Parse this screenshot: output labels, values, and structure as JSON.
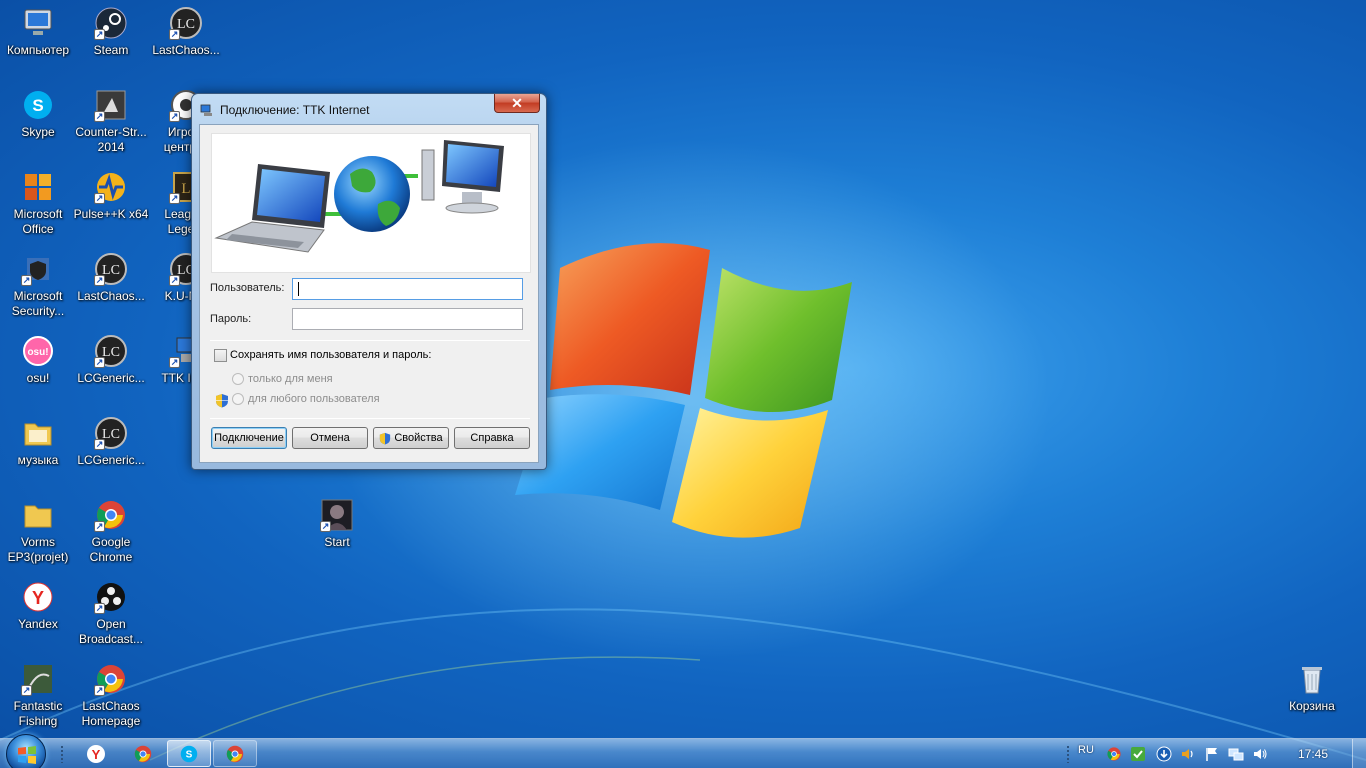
{
  "desktop": {
    "icons": [
      {
        "label": "Компьютер",
        "icon": "computer-icon"
      },
      {
        "label": "Steam",
        "icon": "steam-icon"
      },
      {
        "label": "LastChaos...",
        "icon": "lastchaos-icon"
      },
      {
        "label": "Skype",
        "icon": "skype-icon"
      },
      {
        "label": "Counter-Str... 2014",
        "icon": "counter-strike-icon"
      },
      {
        "label": "Игро... центр@",
        "icon": "game-center-icon"
      },
      {
        "label": "Microsoft Office",
        "icon": "office-icon"
      },
      {
        "label": "Pulse++K x64",
        "icon": "pulse-icon"
      },
      {
        "label": "Leagu... Lege...",
        "icon": "league-icon"
      },
      {
        "label": "Microsoft Security...",
        "icon": "security-icon"
      },
      {
        "label": "LastChaos...",
        "icon": "lastchaos-icon"
      },
      {
        "label": "K.U-N...",
        "icon": "lastchaos-icon"
      },
      {
        "label": "osu!",
        "icon": "osu-icon"
      },
      {
        "label": "LCGeneric...",
        "icon": "lastchaos-icon"
      },
      {
        "label": "TTK Int...",
        "icon": "network-connection-icon"
      },
      {
        "label": "музыка",
        "icon": "folder-icon"
      },
      {
        "label": "LCGeneric...",
        "icon": "lastchaos-icon"
      },
      {
        "label": "Vorms EP3(projet)",
        "icon": "folder-icon"
      },
      {
        "label": "Google Chrome",
        "icon": "chrome-icon"
      },
      {
        "label": "Start",
        "icon": "start-game-icon"
      },
      {
        "label": "Yandex",
        "icon": "yandex-icon"
      },
      {
        "label": "Open Broadcast...",
        "icon": "obs-icon"
      },
      {
        "label": "Fantastic Fishing",
        "icon": "fishing-icon"
      },
      {
        "label": "LastChaos Homepage",
        "icon": "chrome-icon"
      },
      {
        "label": "Корзина",
        "icon": "recycle-bin-icon"
      }
    ]
  },
  "dialog": {
    "title": "Подключение: TTK Internet",
    "close_label": "✕",
    "username_label": "Пользователь:",
    "username_value": "",
    "password_label": "Пароль:",
    "password_value": "",
    "save_credentials_label": "Сохранять имя пользователя и пароль:",
    "save_credentials_checked": false,
    "option_only_me": "только для меня",
    "option_any_user": "для любого пользователя",
    "buttons": {
      "connect": "Подключение",
      "cancel": "Отмена",
      "properties": "Свойства",
      "help": "Справка"
    }
  },
  "taskbar": {
    "pinned": [
      {
        "name": "yandex-browser",
        "icon": "yandex-icon"
      },
      {
        "name": "google-chrome",
        "icon": "chrome-icon"
      },
      {
        "name": "skype",
        "icon": "skype-icon",
        "state": "active"
      },
      {
        "name": "chrome-window",
        "icon": "chrome-icon",
        "state": "open"
      }
    ],
    "language": "RU",
    "tray_icons": [
      "chrome-icon",
      "security-check-icon",
      "download-icon",
      "volume-icon",
      "flag-icon",
      "network-icon",
      "speaker-icon"
    ],
    "clock": "17:45"
  },
  "colors": {
    "desktop_blue": "#1164c0",
    "dialog_frame": "#a9c6e6",
    "close_red": "#c23b22"
  }
}
